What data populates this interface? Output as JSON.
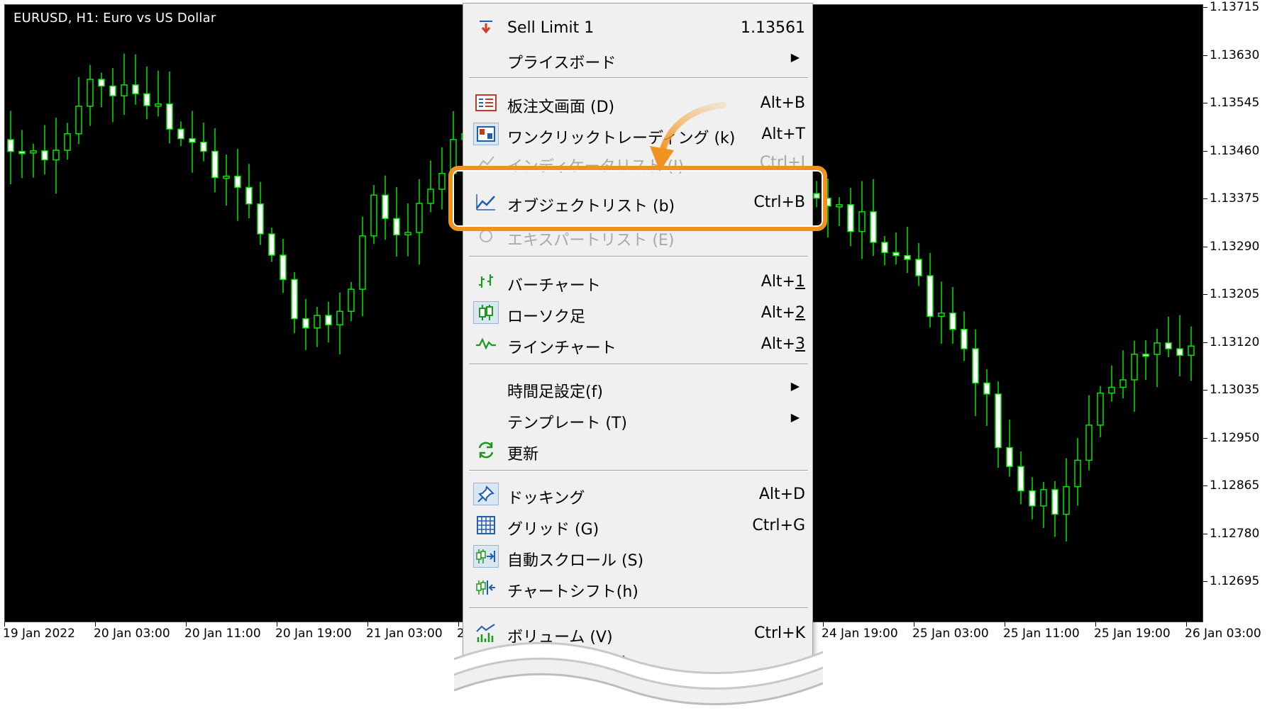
{
  "chart": {
    "title": "EURUSD, H1:  Euro vs US Dollar",
    "price_labels": [
      "1.13715",
      "1.13630",
      "1.13545",
      "1.13460",
      "1.13375",
      "1.13290",
      "1.13205",
      "1.13120",
      "1.13035",
      "1.12950",
      "1.12865",
      "1.12780",
      "1.12695"
    ],
    "time_labels": [
      "19 Jan 2022",
      "20 Jan 03:00",
      "20 Jan 11:00",
      "20 Jan 19:00",
      "21 Jan 03:00",
      "2",
      "24 Jan 19:00",
      "25 Jan 03:00",
      "25 Jan 11:00",
      "25 Jan 19:00",
      "26 Jan 03:00"
    ],
    "colors": {
      "background": "#000000",
      "bull": "#000000",
      "bear": "#ffffff",
      "wick": "#00e600"
    }
  },
  "menu": {
    "items": [
      {
        "icon": "sell-limit-icon",
        "label": "Sell Limit 1",
        "shortcut": "1.13561"
      },
      {
        "icon": "",
        "label": "プライスボード",
        "submenu": "▶"
      },
      {
        "icon": "order-screen-icon",
        "label": "板注文画面 (D)",
        "shortcut": "Alt+B"
      },
      {
        "icon": "one-click-trading-icon",
        "label": "ワンクリックトレーディング (k)",
        "shortcut": "Alt+T"
      },
      {
        "icon": "indicator-list-icon",
        "label": "インディケータリスト (I)",
        "shortcut": "Ctrl+I"
      },
      {
        "icon": "object-list-icon",
        "label": "オブジェクトリスト (b)",
        "shortcut": "Ctrl+B"
      },
      {
        "icon": "expert-list-icon",
        "label": "エキスパートリスト (E)",
        "shortcut": ""
      },
      {
        "icon": "bar-chart-icon",
        "label": "バーチャート",
        "shortcut_prefix": "Alt+",
        "shortcut_key": "1"
      },
      {
        "icon": "candlestick-icon",
        "label": "ローソク足",
        "shortcut_prefix": "Alt+",
        "shortcut_key": "2"
      },
      {
        "icon": "line-chart-icon",
        "label": "ラインチャート",
        "shortcut_prefix": "Alt+",
        "shortcut_key": "3"
      },
      {
        "icon": "",
        "label": "時間足設定(f)",
        "submenu": "▶"
      },
      {
        "icon": "",
        "label": "テンプレート (T)",
        "submenu": "▶"
      },
      {
        "icon": "refresh-icon",
        "label": "更新"
      },
      {
        "icon": "docking-pin-icon",
        "label": "ドッキング",
        "shortcut": "Alt+D"
      },
      {
        "icon": "grid-icon",
        "label": "グリッド (G)",
        "shortcut": "Ctrl+G"
      },
      {
        "icon": "auto-scroll-icon",
        "label": "自動スクロール (S)"
      },
      {
        "icon": "chart-shift-icon",
        "label": "チャートシフト(h)"
      },
      {
        "icon": "volume-icon",
        "label": "ボリューム (V)",
        "shortcut": "Ctrl+K"
      },
      {
        "icon": "",
        "label": "(K)"
      }
    ]
  },
  "annotation": {
    "highlight_color": "#f0921f"
  }
}
